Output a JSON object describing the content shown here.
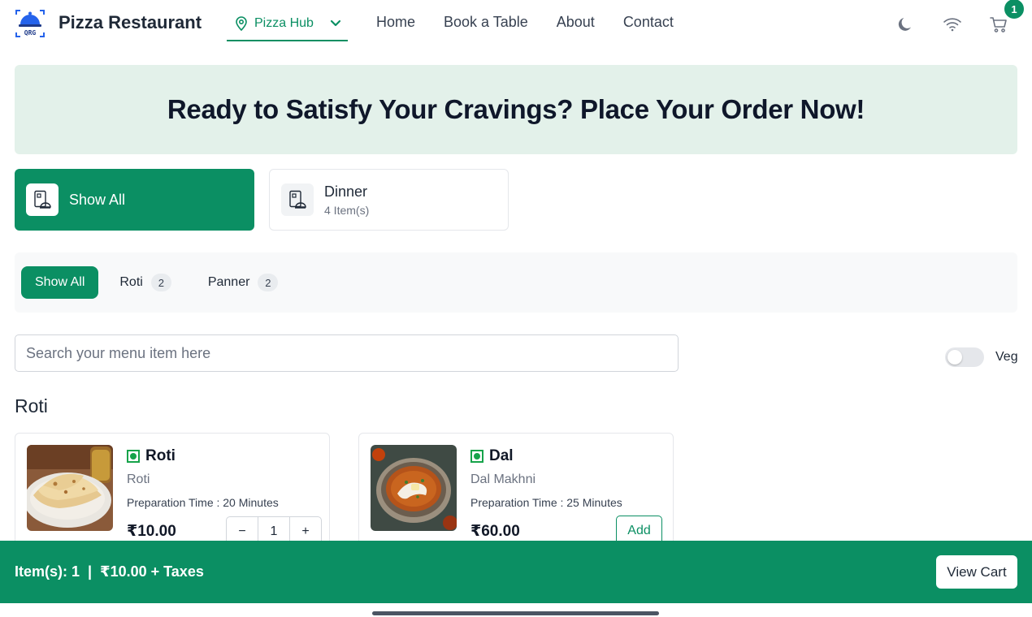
{
  "header": {
    "brand": "Pizza Restaurant",
    "location": "Pizza Hub",
    "nav": [
      "Home",
      "Book a Table",
      "About",
      "Contact"
    ],
    "cart_count": "1",
    "icons": [
      "logo-icon",
      "location-pin-icon",
      "chevron-down-icon",
      "moon-icon",
      "wifi-icon",
      "cart-icon"
    ]
  },
  "hero": {
    "title": "Ready to Satisfy Your Cravings? Place Your Order Now!"
  },
  "categories": [
    {
      "title": "Show All",
      "subtitle": "",
      "active": true
    },
    {
      "title": "Dinner",
      "subtitle": "4 Item(s)",
      "active": false
    }
  ],
  "filters": [
    {
      "label": "Show All",
      "count": "",
      "active": true
    },
    {
      "label": "Roti",
      "count": "2",
      "active": false
    },
    {
      "label": "Panner",
      "count": "2",
      "active": false
    }
  ],
  "search": {
    "placeholder": "Search your menu item here",
    "value": ""
  },
  "veg_toggle": {
    "label": "Veg",
    "on": false
  },
  "section": {
    "title": "Roti"
  },
  "items": [
    {
      "name": "Roti",
      "description": "Roti",
      "prep": "Preparation Time : 20 Minutes",
      "price": "₹10.00",
      "quantity": "1",
      "minus": "−",
      "plus": "+"
    },
    {
      "name": "Dal",
      "description": "Dal Makhni",
      "prep": "Preparation Time : 25 Minutes",
      "price": "₹60.00",
      "add_label": "Add"
    }
  ],
  "cart_bar": {
    "summary": "Item(s): 1  |  ₹10.00 + Taxes",
    "button": "View Cart"
  },
  "colors": {
    "accent": "#0b8f63",
    "hero_bg": "#e3f1ea",
    "veg": "#16a34a"
  }
}
